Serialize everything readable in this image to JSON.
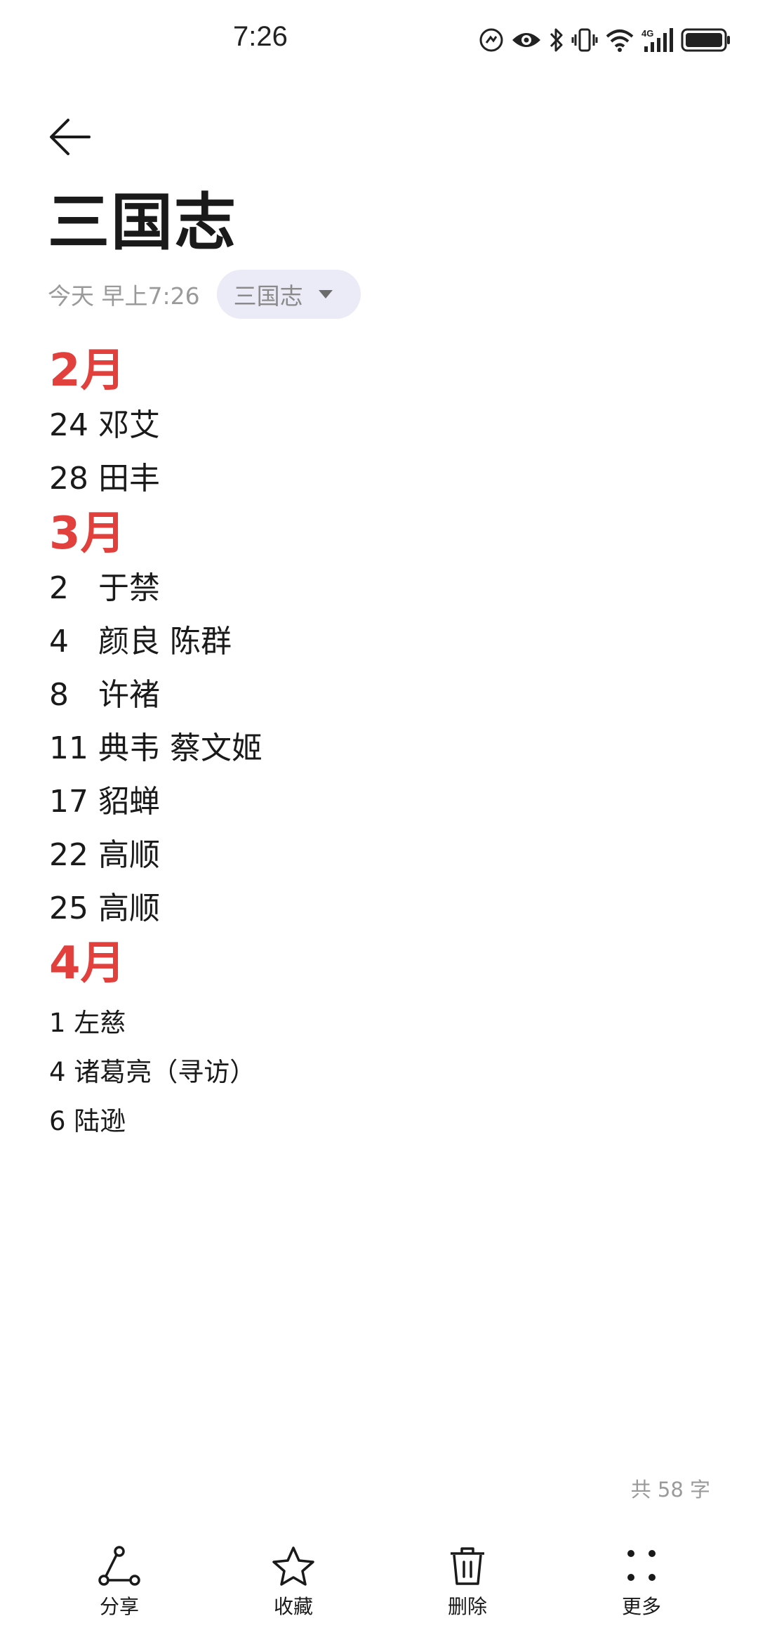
{
  "status_bar": {
    "time": "7:26",
    "network": "4G"
  },
  "header": {
    "back_icon": "arrow-left-icon"
  },
  "note": {
    "title": "三国志",
    "timestamp": "今天 早上7:26",
    "folder": "三国志",
    "sections": [
      {
        "month": "2月",
        "entries": [
          "24 邓艾",
          "28 田丰"
        ]
      },
      {
        "month": "3月",
        "entries": [
          "2   于禁",
          "4   颜良 陈群",
          "8   许褚",
          "11 典韦 蔡文姬",
          "17 貂蝉",
          "22 高顺",
          "25 高顺"
        ]
      },
      {
        "month": "4月",
        "entries": [
          "1 左慈",
          "4 诸葛亮（寻访）",
          "6 陆逊"
        ]
      }
    ],
    "word_count": "共 58 字"
  },
  "toolbar": {
    "share": "分享",
    "favorite": "收藏",
    "delete": "删除",
    "more": "更多"
  },
  "colors": {
    "accent_month": "#e2403d",
    "chip_bg": "#ebebf7",
    "muted_text": "#9a9a9a"
  }
}
